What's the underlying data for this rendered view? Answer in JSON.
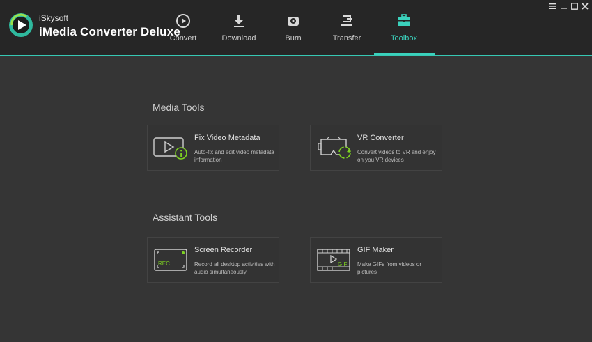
{
  "app": {
    "vendor": "iSkysoft",
    "name": "iMedia Converter Deluxe"
  },
  "window_controls": [
    {
      "name": "menu-icon"
    },
    {
      "name": "minimize-icon"
    },
    {
      "name": "maximize-icon"
    },
    {
      "name": "close-icon"
    }
  ],
  "nav": {
    "active": "Toolbox",
    "items": [
      {
        "label": "Convert",
        "icon": "convert-icon"
      },
      {
        "label": "Download",
        "icon": "download-icon"
      },
      {
        "label": "Burn",
        "icon": "burn-icon"
      },
      {
        "label": "Transfer",
        "icon": "transfer-icon"
      },
      {
        "label": "Toolbox",
        "icon": "toolbox-icon"
      }
    ]
  },
  "sections": {
    "media_tools": {
      "title": "Media Tools",
      "cards": [
        {
          "title": "Fix Video Metadata",
          "desc": "Auto-fix and edit video metadata information",
          "icon": "fix-metadata-icon"
        },
        {
          "title": "VR Converter",
          "desc": "Convert videos to VR and enjoy on you VR devices",
          "icon": "vr-converter-icon"
        }
      ]
    },
    "assistant_tools": {
      "title": "Assistant Tools",
      "cards": [
        {
          "title": "Screen Recorder",
          "desc": "Record all desktop activities with audio simultaneously",
          "icon": "screen-recorder-icon",
          "icon_text": "REC"
        },
        {
          "title": "GIF Maker",
          "desc": "Make GIFs from videos or pictures",
          "icon": "gif-maker-icon",
          "icon_text": "GIF"
        }
      ]
    }
  },
  "colors": {
    "accent": "#3bd2bd",
    "highlight_green": "#7ed321",
    "header_bg": "#262626",
    "content_bg": "#353535"
  }
}
